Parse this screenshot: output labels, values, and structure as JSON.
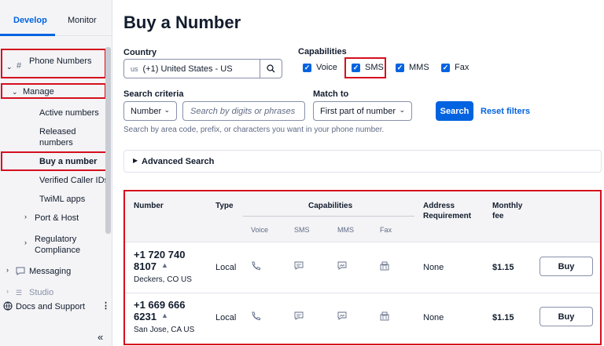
{
  "sidebar": {
    "tabs": {
      "develop": "Develop",
      "monitor": "Monitor"
    },
    "phone_numbers": "Phone Numbers",
    "manage": "Manage",
    "items": {
      "active": "Active numbers",
      "released": "Released numbers",
      "buy": "Buy a number",
      "verified": "Verified Caller IDs",
      "twiml": "TwiML apps",
      "port_host": "Port & Host",
      "regulatory": "Regulatory Compliance",
      "messaging": "Messaging",
      "studio": "Studio",
      "docs": "Docs and Support"
    },
    "collapse": "«"
  },
  "page": {
    "title": "Buy a Number"
  },
  "country": {
    "label": "Country",
    "prefix": "us",
    "value": "(+1) United States - US"
  },
  "capabilities": {
    "label": "Capabilities",
    "voice": "Voice",
    "sms": "SMS",
    "mms": "MMS",
    "fax": "Fax"
  },
  "search_criteria": {
    "label": "Search criteria",
    "value": "Number",
    "placeholder": "Search by digits or phrases"
  },
  "match_to": {
    "label": "Match to",
    "value": "First part of number"
  },
  "buttons": {
    "search": "Search",
    "reset": "Reset filters",
    "buy": "Buy"
  },
  "help_text": "Search by area code, prefix, or characters you want in your phone number.",
  "advanced": "Advanced Search",
  "table": {
    "headers": {
      "number": "Number",
      "type": "Type",
      "capabilities": "Capabilities",
      "address": "Address Requirement",
      "fee": "Monthly fee",
      "voice": "Voice",
      "sms": "SMS",
      "mms": "MMS",
      "fax": "Fax"
    },
    "rows": [
      {
        "num1": "+1 720 740",
        "num2": "8107",
        "location": "Deckers, CO US",
        "type": "Local",
        "address": "None",
        "fee": "$1.15"
      },
      {
        "num1": "+1 669 666",
        "num2": "6231",
        "location": "San Jose, CA US",
        "type": "Local",
        "address": "None",
        "fee": "$1.15"
      }
    ]
  }
}
